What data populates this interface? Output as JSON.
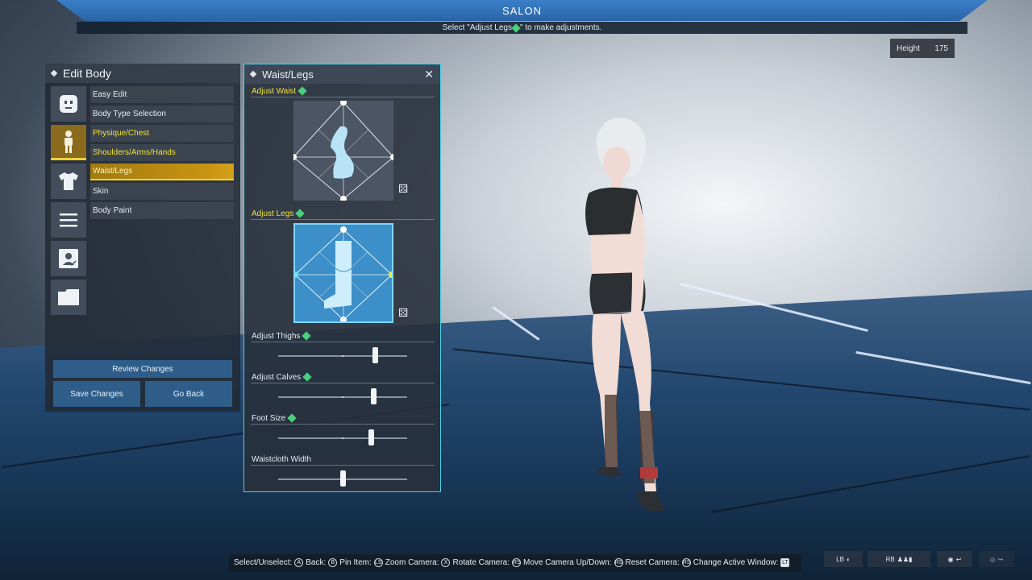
{
  "topbar": {
    "title": "SALON",
    "instruction_prefix": "Select \"Adjust Legs",
    "instruction_suffix": "\" to make adjustments."
  },
  "height": {
    "label": "Height",
    "value": "175"
  },
  "edit_body": {
    "title": "Edit Body",
    "categories": [
      "face-icon",
      "body-icon",
      "outfit-icon",
      "menu-icon",
      "id-card-icon",
      "folder-icon"
    ],
    "items": [
      {
        "label": "Easy Edit",
        "state": "normal"
      },
      {
        "label": "Body Type Selection",
        "state": "normal"
      },
      {
        "label": "Physique/Chest",
        "state": "highlight"
      },
      {
        "label": "Shoulders/Arms/Hands",
        "state": "highlight"
      },
      {
        "label": "Waist/Legs",
        "state": "selected"
      },
      {
        "label": "Skin",
        "state": "normal"
      },
      {
        "label": "Body Paint",
        "state": "normal"
      }
    ],
    "review_label": "Review Changes",
    "save_label": "Save Changes",
    "back_label": "Go Back"
  },
  "waist_legs": {
    "title": "Waist/Legs",
    "adjust_waist": "Adjust Waist",
    "adjust_legs": "Adjust Legs",
    "sliders": [
      {
        "label": "Adjust Thighs",
        "value": 0.75,
        "gem": true
      },
      {
        "label": "Adjust Calves",
        "value": 0.74,
        "gem": true
      },
      {
        "label": "Foot Size",
        "value": 0.72,
        "gem": true
      },
      {
        "label": "Waistcloth Width",
        "value": 0.5,
        "gem": false
      }
    ]
  },
  "controls": [
    {
      "text": "Select/Unselect:",
      "icon": "A"
    },
    {
      "text": "Back:",
      "icon": "B"
    },
    {
      "text": "Pin Item:",
      "icon": "LS"
    },
    {
      "text": "Zoom Camera:",
      "icon": "X"
    },
    {
      "text": "Rotate Camera:",
      "icon": "RS"
    },
    {
      "text": "Move Camera Up/Down:",
      "icon": "RS"
    },
    {
      "text": "Reset Camera:",
      "icon": "RS"
    },
    {
      "text": "Change Active Window:",
      "icon": "LT"
    }
  ],
  "mini_buttons": {
    "lb": "LB",
    "rb": "RB"
  },
  "colors": {
    "accent_blue": "#2e5d8a",
    "highlight_yellow": "#f0e23a",
    "selected_gold": "#c79412",
    "panel_border": "#4fd1e8"
  }
}
